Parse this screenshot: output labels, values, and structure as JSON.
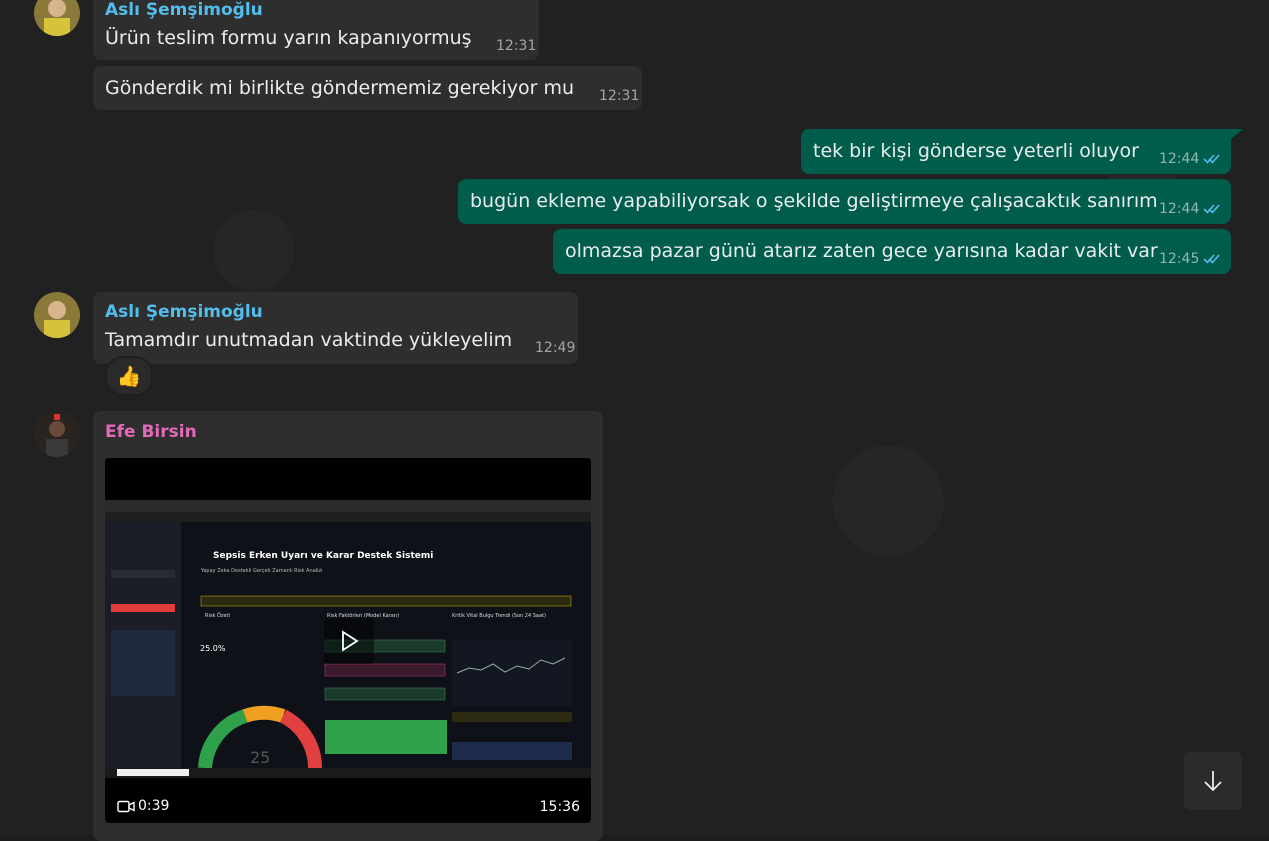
{
  "colors": {
    "incoming_bubble": "#2e2e2e",
    "outgoing_bubble": "#005c4b",
    "sender_asli": "#53bdeb",
    "sender_efe": "#e26ab6",
    "read_ticks": "#53bdeb"
  },
  "messages": [
    {
      "sender": "Aslı Şemşimoğlu",
      "text": "Ürün teslim formu yarın kapanıyormuş",
      "time": "12:31"
    },
    {
      "text": "Gönderdik mi birlikte göndermemiz gerekiyor mu",
      "time": "12:31"
    },
    {
      "text": "tek bir kişi gönderse yeterli oluyor",
      "time": "12:44"
    },
    {
      "text": "bugün ekleme yapabiliyorsak o şekilde geliştirmeye çalışacaktık sanırım",
      "time": "12:44"
    },
    {
      "text": "olmazsa pazar günü atarız zaten gece yarısına kadar vakit var",
      "time": "12:45"
    },
    {
      "sender": "Aslı Şemşimoğlu",
      "text": "Tamamdır unutmadan vaktinde yükleyelim",
      "time": "12:49",
      "reaction": "👍"
    },
    {
      "sender": "Efe Birsin",
      "video_duration": "0:39",
      "time": "15:36"
    }
  ],
  "video_preview": {
    "title": "Sepsis Erken Uyarı ve Karar Destek Sistemi",
    "subtitle": "Yapay Zeka Destekli Gerçek Zamanlı Risk Analizi",
    "risk_label": "Risk Özeti",
    "risk_value": "25.0%",
    "factors_label": "Risk Faktörleri (Model Kararı)",
    "trend_label": "Kritik Vital Bulgu Trendi (Son 24 Saat)",
    "gauge_value": "25"
  },
  "icons": {
    "scroll_down": "arrow-down-icon",
    "play": "play-icon",
    "video_camera": "video-camera-icon"
  }
}
